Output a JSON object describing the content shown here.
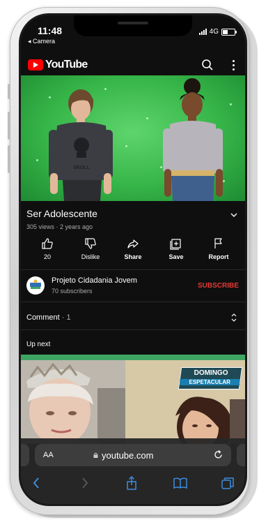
{
  "status_bar": {
    "time": "11:48",
    "back_app": "◂ Camera",
    "network": "4G"
  },
  "app": {
    "name": "YouTube"
  },
  "video": {
    "title": "Ser Adolescente",
    "meta": "305 views · 2 years ago",
    "shirt_text": "SKULL"
  },
  "actions": {
    "like_count": "20",
    "dislike_label": "Dislike",
    "share_label": "Share",
    "save_label": "Save",
    "report_label": "Report"
  },
  "channel": {
    "name": "Projeto Cidadania Jovem",
    "subscribers": "70 subscribers",
    "subscribe_label": "SUBSCRIBE"
  },
  "comments": {
    "label": "Comment",
    "count": "· 1"
  },
  "up_next": {
    "label": "Up next",
    "thumbnail_badge_line1": "DOMINGO",
    "thumbnail_badge_line2": "ESPETACULAR"
  },
  "browser": {
    "text_size_label": "AA",
    "url": "youtube.com"
  },
  "colors": {
    "accent_red": "#ff0000",
    "subscribe_red": "#e53935",
    "background": "#0f0f0f",
    "video_green": "#36b548"
  },
  "icons": [
    "search-icon",
    "more-icon",
    "chevron-down-icon",
    "thumbs-up-icon",
    "thumbs-down-icon",
    "share-icon",
    "save-icon",
    "flag-icon",
    "sort-toggle-icon",
    "lock-icon",
    "reload-icon",
    "back-icon",
    "forward-icon",
    "share-sheet-icon",
    "bookmarks-icon",
    "tabs-icon"
  ]
}
